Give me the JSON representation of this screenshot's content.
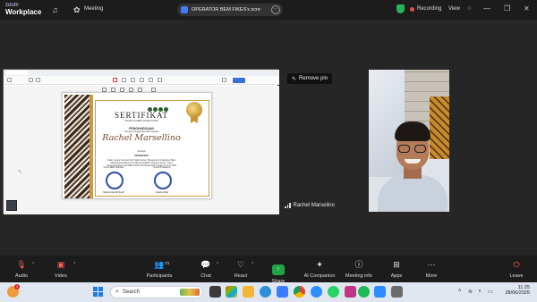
{
  "title_bar": {
    "brand_line1": "zoom",
    "brand_line2": "Workplace",
    "meeting_label": "Meeting",
    "share_title": "OPERATOR BEM FIKES's scre",
    "recording_label": "Recording",
    "view_label": "View"
  },
  "colors": {
    "accent": "#3d7bff",
    "share_green": "#1fa348",
    "record_red": "#e74a4a",
    "shield_green": "#27b35a"
  },
  "shared_screen": {
    "pdf_toolbar_label": "Ask AI Share",
    "certificate": {
      "title": "SERTIFIKAT",
      "number_line": "060/SKV1-E/BEM FIKES/VI/2025",
      "award_line": "PENGHARGAAN",
      "given_to": "Dengan bangga diberikan kepada",
      "recipient_name": "Rachel Marsellino",
      "as_label": "Sebagai",
      "role": "PEMATERI",
      "body_line1": "Dalam acara Seminar Soft Skills Series \"Menjemput Organisasi Bagi",
      "body_line2": "Mahasiswa Akademisi & Menuju IMAMI Unggul & Keren\" yang",
      "body_line3": "diselenggarakan oleh BEM FIKES UNISMA pada tanggal 26 Juni 2025",
      "signer_left_title": "Ketua BEM Fakultas",
      "signer_right_title": "Ketua Pelaksana",
      "signer_left_name": "Muhammad Ali Syarif",
      "signer_right_name": "Indana Zulfa"
    }
  },
  "remove_pin_label": "Remove pin",
  "participant_name": "Rachel Marselino",
  "toolbar": {
    "audio": "Audio",
    "video": "Video",
    "participants": "Participants",
    "participants_count": "73",
    "chat": "Chat",
    "react": "React",
    "share": "Share",
    "ai_companion": "AI Companion",
    "meeting_info": "Meeting info",
    "apps": "Apps",
    "more": "More",
    "leave": "Leave"
  },
  "taskbar": {
    "weather_badge": "1",
    "search_placeholder": "Search",
    "time": "11:25",
    "date": "28/06/2025"
  }
}
